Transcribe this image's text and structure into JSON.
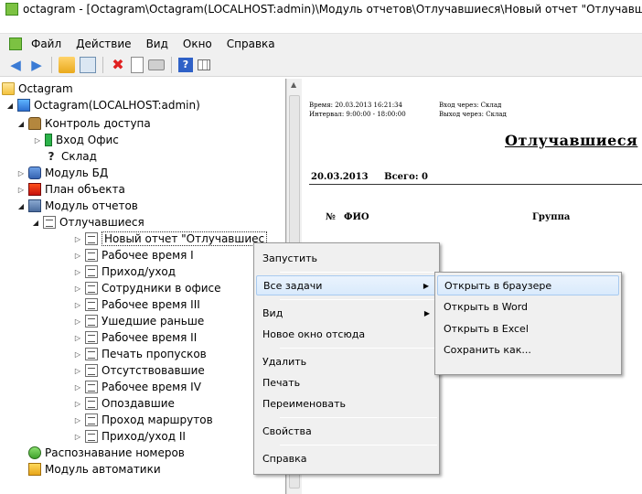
{
  "window": {
    "title": "octagram - [Octagram\\Octagram(LOCALHOST:admin)\\Модуль отчетов\\Отлучавшиеся\\Новый отчет \"Отлучавшиеся\"]"
  },
  "menu": [
    "Файл",
    "Действие",
    "Вид",
    "Окно",
    "Справка"
  ],
  "toolbar": [
    "back-arrow-icon",
    "forward-arrow-icon",
    "folder-up-icon",
    "show-panel-icon",
    "delete-icon",
    "properties-icon",
    "print-icon",
    "help-icon",
    "view-grid-icon"
  ],
  "tree": {
    "root": "Octagram",
    "server": "Octagram(LOCALHOST:admin)",
    "access_control": "Контроль доступа",
    "entry_office": "Вход Офис",
    "warehouse": "Склад",
    "db_module": "Модуль БД",
    "object_plan": "План объекта",
    "reports_module": "Модуль отчетов",
    "absentees": "Отлучавшиеся",
    "new_report": "Новый отчет \"Отлучавшиес",
    "reports": [
      "Рабочее время I",
      "Приход/уход",
      "Сотрудники в офисе",
      "Рабочее время III",
      "Ушедшие раньше",
      "Рабочее время II",
      "Печать пропусков",
      "Отсутствовавшие",
      "Рабочее время IV",
      "Опоздавшие",
      "Проход маршрутов",
      "Приход/уход II"
    ],
    "number_recognition": "Распознавание номеров",
    "automation_module": "Модуль автоматики"
  },
  "report": {
    "time": "Время: 20.03.2013 16:21:34",
    "interval": "Интервал: 9:00:00 - 18:00:00",
    "entry": "Вход через: Склад",
    "exit": "Выход через: Склад",
    "title": "Отлучавшиеся",
    "date": "20.03.2013",
    "total": "Всего: 0",
    "col_no": "№",
    "col_name": "ФИО",
    "col_group": "Группа"
  },
  "context_menu": {
    "run": "Запустить",
    "all_tasks": "Все задачи",
    "view": "Вид",
    "new_window": "Новое окно отсюда",
    "delete": "Удалить",
    "print": "Печать",
    "rename": "Переименовать",
    "properties": "Свойства",
    "help": "Справка"
  },
  "submenu": {
    "open_browser": "Открыть в браузере",
    "open_word": "Открыть в Word",
    "open_excel": "Открыть в Excel",
    "save_as": "Сохранить как..."
  },
  "colors": {
    "highlight": "#d9eafc",
    "menu_bg": "#f0f0f0"
  }
}
